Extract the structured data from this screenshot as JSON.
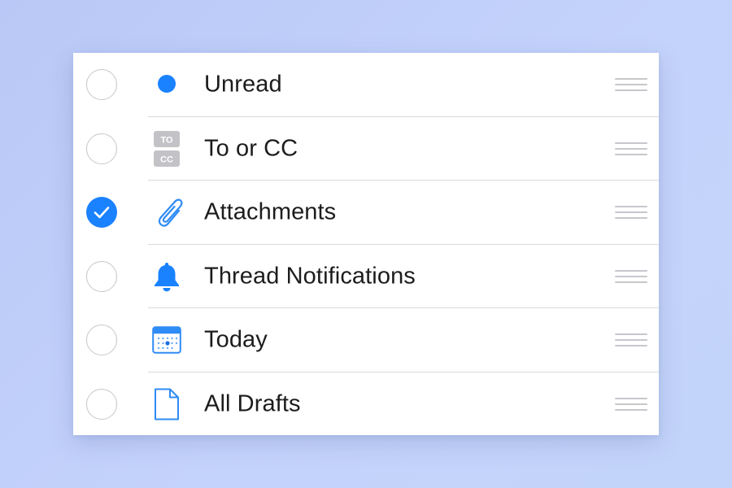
{
  "filters": [
    {
      "label": "Unread",
      "icon": "unread-dot-icon",
      "checked": false
    },
    {
      "label": "To or CC",
      "icon": "to-cc-icon",
      "checked": false,
      "icon_text": [
        "TO",
        "CC"
      ]
    },
    {
      "label": "Attachments",
      "icon": "paperclip-icon",
      "checked": true
    },
    {
      "label": "Thread Notifications",
      "icon": "bell-icon",
      "checked": false
    },
    {
      "label": "Today",
      "icon": "calendar-icon",
      "checked": false
    },
    {
      "label": "All Drafts",
      "icon": "document-icon",
      "checked": false
    }
  ],
  "colors": {
    "accent": "#1a82ff",
    "icon_gray": "#c0c0c4",
    "background": "#c0d0fa"
  }
}
